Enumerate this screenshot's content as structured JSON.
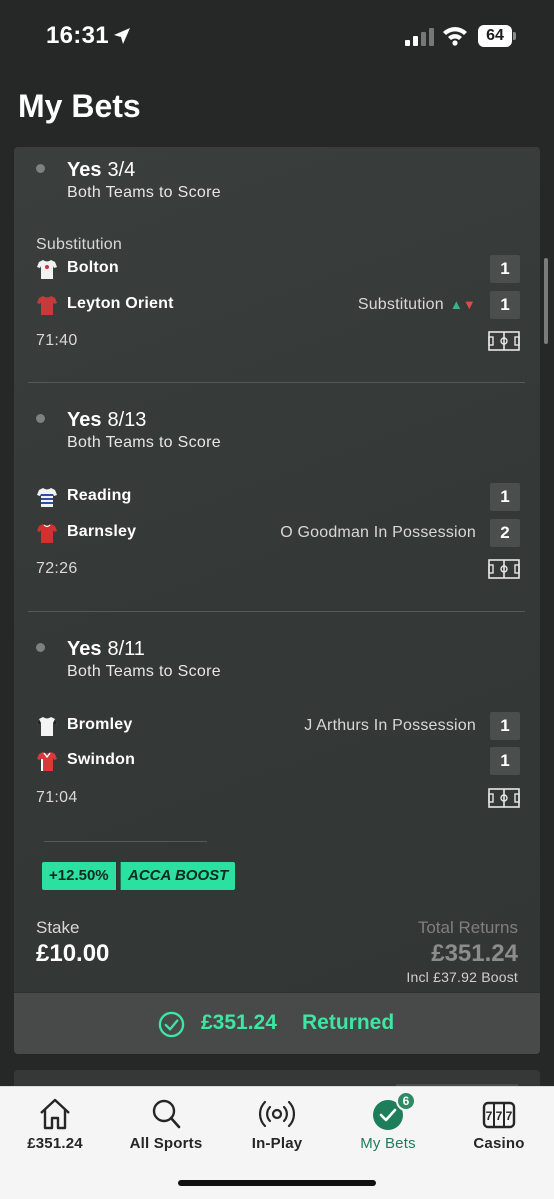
{
  "status_bar": {
    "time": "16:31",
    "battery": "64"
  },
  "page": {
    "title": "My Bets"
  },
  "legs": [
    {
      "selection": "Yes",
      "odds": "3/4",
      "market": "Both Teams to Score",
      "event_label": "Substitution",
      "home": {
        "team": "Bolton",
        "score": "1",
        "event": ""
      },
      "away": {
        "team": "Leyton Orient",
        "score": "1",
        "event": "Substitution"
      },
      "clock": "71:40"
    },
    {
      "selection": "Yes",
      "odds": "8/13",
      "market": "Both Teams to Score",
      "home": {
        "team": "Reading",
        "score": "1",
        "event": ""
      },
      "away": {
        "team": "Barnsley",
        "score": "2",
        "event": "O Goodman In Possession"
      },
      "clock": "72:26"
    },
    {
      "selection": "Yes",
      "odds": "8/11",
      "market": "Both Teams to Score",
      "home": {
        "team": "Bromley",
        "score": "1",
        "event": "J Arthurs In Possession"
      },
      "away": {
        "team": "Swindon",
        "score": "1",
        "event": ""
      },
      "clock": "71:04"
    }
  ],
  "boost": {
    "percent": "+12.50%",
    "label": "ACCA BOOST"
  },
  "stake": {
    "label": "Stake",
    "value": "£10.00"
  },
  "returns": {
    "label": "Total Returns",
    "value": "£351.24",
    "boost_note": "Incl £37.92 Boost"
  },
  "result": {
    "amount": "£351.24",
    "text": "Returned"
  },
  "tabbar": {
    "tabs": [
      {
        "label": "£351.24",
        "icon": "home-icon"
      },
      {
        "label": "All Sports",
        "icon": "search-icon"
      },
      {
        "label": "In-Play",
        "icon": "live-broadcast-icon"
      },
      {
        "label": "My Bets",
        "icon": "checkmark-icon",
        "badge": "6",
        "active": true
      },
      {
        "label": "Casino",
        "icon": "slot-machine-icon"
      }
    ]
  },
  "colors": {
    "accent_green": "#3ee6a4",
    "boost_green": "#2be0a0",
    "background": "#262827"
  }
}
